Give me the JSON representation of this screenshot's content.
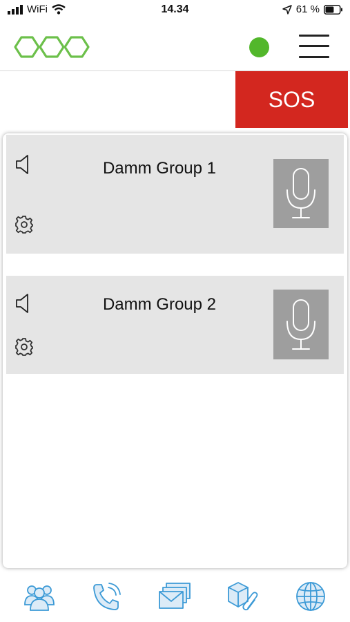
{
  "status_bar": {
    "carrier": "WiFi",
    "time": "14.34",
    "battery_percent": "61 %",
    "battery_level": 0.61
  },
  "header": {
    "logo_icon": "honeycomb-logo",
    "online_indicator_color": "#52b72b",
    "menu_icon": "hamburger-menu-icon"
  },
  "sos": {
    "label": "SOS",
    "color": "#d3271f"
  },
  "groups": [
    {
      "name": "Damm Group 1",
      "speaker_icon": "speaker-icon",
      "settings_icon": "gear-icon",
      "talk_icon": "microphone-icon"
    },
    {
      "name": "Damm Group 2",
      "speaker_icon": "speaker-icon",
      "settings_icon": "gear-icon",
      "talk_icon": "microphone-icon"
    }
  ],
  "bottom_nav": {
    "accent_color": "#3c9ad6",
    "items": [
      {
        "icon": "users-group-icon"
      },
      {
        "icon": "phone-call-icon"
      },
      {
        "icon": "messages-icon"
      },
      {
        "icon": "package-attachment-icon"
      },
      {
        "icon": "globe-icon"
      }
    ]
  }
}
